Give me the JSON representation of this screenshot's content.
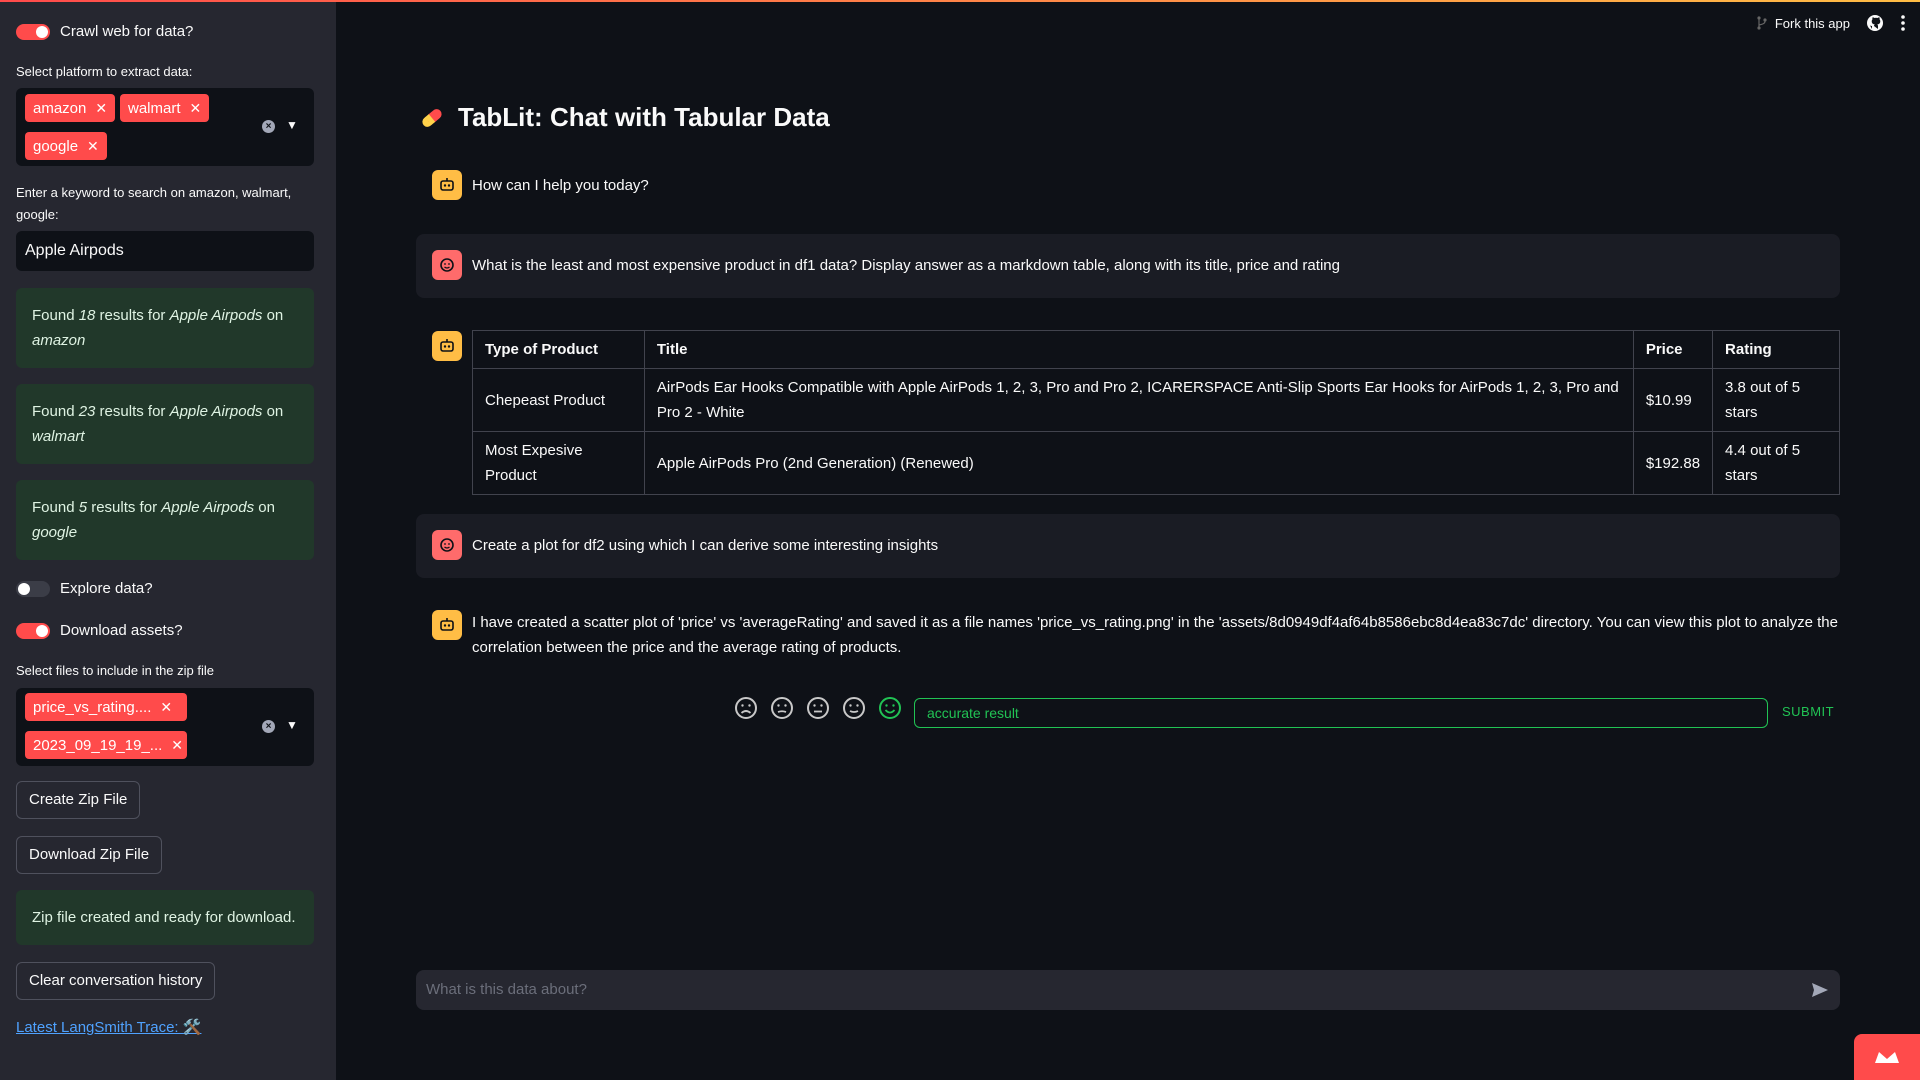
{
  "toolbar": {
    "fork_label": "Fork this app"
  },
  "sidebar": {
    "crawl_toggle_label": "Crawl web for data?",
    "platform_label": "Select platform to extract data:",
    "platforms": [
      "amazon",
      "walmart",
      "google"
    ],
    "keyword_label": "Enter a keyword to search on amazon, walmart, google:",
    "keyword_value": "Apple Airpods",
    "results": [
      {
        "prefix": "Found ",
        "count": "18",
        "mid": " results for ",
        "term": "Apple Airpods",
        "on": " on",
        "platform": "amazon"
      },
      {
        "prefix": "Found ",
        "count": "23",
        "mid": " results for ",
        "term": "Apple Airpods",
        "on": " on",
        "platform": "walmart"
      },
      {
        "prefix": "Found ",
        "count": "5",
        "mid": " results for ",
        "term": "Apple Airpods",
        "on": " on",
        "platform": "google"
      }
    ],
    "explore_toggle_label": "Explore data?",
    "download_toggle_label": "Download assets?",
    "files_label": "Select files to include in the zip file",
    "files": [
      "price_vs_rating....",
      "2023_09_19_19_..."
    ],
    "create_zip_label": "Create Zip File",
    "download_zip_label": "Download Zip File",
    "zip_status": "Zip file created and ready for download.",
    "clear_history_label": "Clear conversation history",
    "trace_link": "Latest LangSmith Trace: 🛠️"
  },
  "main": {
    "title": "TabLit: Chat with Tabular Data",
    "messages": {
      "greeting": "How can I help you today?",
      "user_q1": "What is the least and most expensive product in df1 data? Display answer as a markdown table, along with its title, price and rating",
      "user_q2": "Create a plot for df2 using which I can derive some interesting insights",
      "bot_a2": "I have created a scatter plot of 'price' vs 'averageRating' and saved it as a file names 'price_vs_rating.png' in the 'assets/8d0949df4af64b8586ebc8d4ea83c7dc' directory. You can view this plot to analyze the correlation between the price and the average rating of products."
    },
    "table": {
      "headers": [
        "Type of Product",
        "Title",
        "Price",
        "Rating"
      ],
      "rows": [
        [
          "Chepeast Product",
          "AirPods Ear Hooks Compatible with Apple AirPods 1, 2, 3, Pro and Pro 2, ICARERSPACE Anti-Slip Sports Ear Hooks for AirPods 1, 2, 3, Pro and Pro 2 - White",
          "$10.99",
          "3.8 out of 5 stars"
        ],
        [
          "Most Expesive Product",
          "Apple AirPods Pro (2nd Generation) (Renewed)",
          "$192.88",
          "4.4 out of 5 stars"
        ]
      ]
    },
    "feedback": {
      "value": "accurate result",
      "submit_label": "SUBMIT"
    },
    "chat_input_placeholder": "What is this data about?"
  },
  "colors": {
    "accent": "#ff4b4b",
    "success_bg": "#21382a",
    "feedback_green": "#21c354",
    "bot_avatar": "#ffbd45",
    "user_avatar": "#ff6b6b"
  }
}
